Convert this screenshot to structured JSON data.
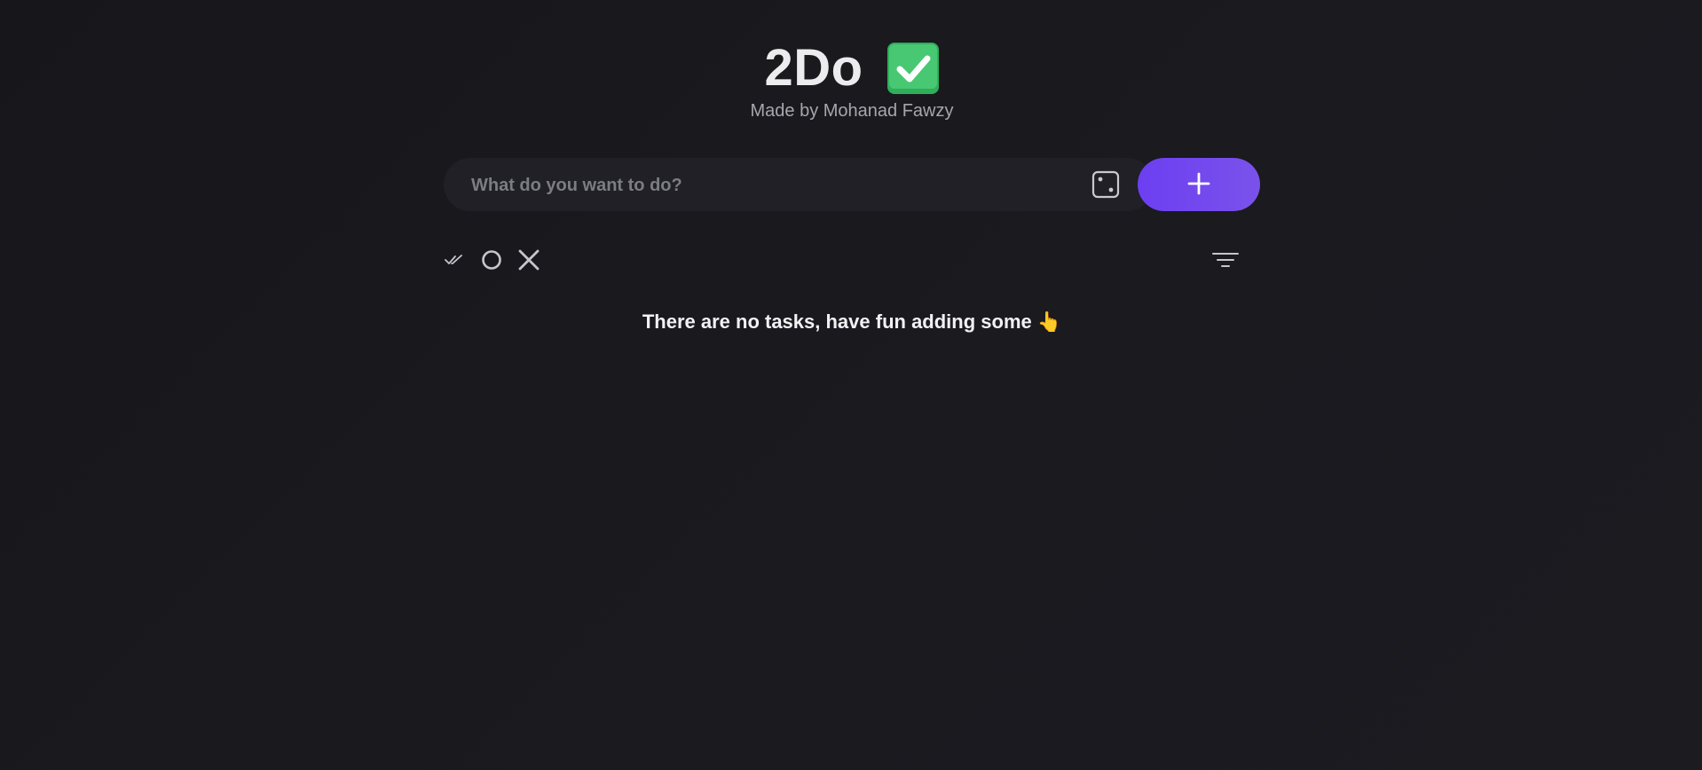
{
  "header": {
    "title": "2Do",
    "title_emoji_icon": "check-mark-button-icon",
    "subtitle": "Made by Mohanad Fawzy"
  },
  "task_input": {
    "placeholder": "What do you want to do?",
    "value": ""
  },
  "icons": {
    "random": "dice-icon",
    "add": "plus-icon",
    "select_all": "double-check-icon",
    "circle": "circle-icon",
    "close": "close-icon",
    "sort": "filter-icon"
  },
  "empty_state": {
    "text": "There are no tasks, have fun adding some",
    "emoji": "👆"
  },
  "colors": {
    "background": "#19191e",
    "input_background": "#202026",
    "accent": "#6c3ff2",
    "check_green": "#3cc86a"
  }
}
